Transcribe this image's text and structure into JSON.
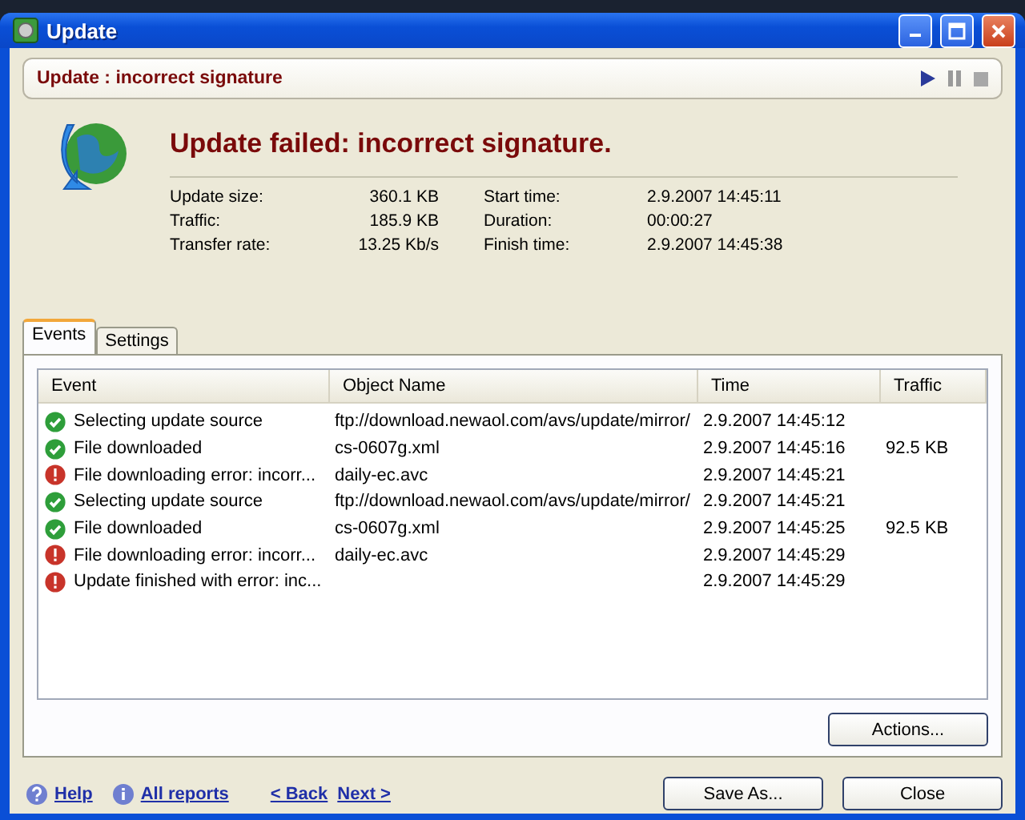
{
  "window": {
    "title": "Update"
  },
  "header": {
    "title": "Update : incorrect signature"
  },
  "status": {
    "heading": "Update failed: incorrect signature."
  },
  "info": [
    {
      "label": "Update size:",
      "value": "360.1 KB"
    },
    {
      "label": "Traffic:",
      "value": "185.9 KB"
    },
    {
      "label": "Transfer rate:",
      "value": "13.25 Kb/s"
    },
    {
      "label": "Start time:",
      "value": "2.9.2007 14:45:11"
    },
    {
      "label": "Duration:",
      "value": "00:00:27"
    },
    {
      "label": "Finish time:",
      "value": "2.9.2007 14:45:38"
    }
  ],
  "tabs": [
    {
      "label": "Events",
      "selected": true
    },
    {
      "label": "Settings",
      "selected": false
    }
  ],
  "table": {
    "columns": [
      "Event",
      "Object Name",
      "Time",
      "Traffic"
    ],
    "rows": [
      {
        "kind": "ok",
        "event": "Selecting update source",
        "object": "ftp://download.newaol.com/avs/update/mirror/",
        "time": "2.9.2007 14:45:12",
        "traffic": ""
      },
      {
        "kind": "ok",
        "event": "File downloaded",
        "object": "cs-0607g.xml",
        "time": "2.9.2007 14:45:16",
        "traffic": "92.5 KB"
      },
      {
        "kind": "error",
        "event": "File downloading error: incorr...",
        "object": "daily-ec.avc",
        "time": "2.9.2007 14:45:21",
        "traffic": ""
      },
      {
        "kind": "ok",
        "event": "Selecting update source",
        "object": "ftp://download.newaol.com/avs/update/mirror/",
        "time": "2.9.2007 14:45:21",
        "traffic": ""
      },
      {
        "kind": "ok",
        "event": "File downloaded",
        "object": "cs-0607g.xml",
        "time": "2.9.2007 14:45:25",
        "traffic": "92.5 KB"
      },
      {
        "kind": "error",
        "event": "File downloading error: incorr...",
        "object": "daily-ec.avc",
        "time": "2.9.2007 14:45:29",
        "traffic": ""
      },
      {
        "kind": "error",
        "event": "Update finished with error: inc...",
        "object": "",
        "time": "2.9.2007 14:45:29",
        "traffic": ""
      }
    ]
  },
  "actions_button": "Actions...",
  "footer": {
    "links": [
      {
        "kind": "help",
        "label": "Help"
      },
      {
        "kind": "info",
        "label": "All reports"
      },
      {
        "kind": "plain",
        "label": "< Back"
      },
      {
        "kind": "plain",
        "label": "Next >"
      }
    ],
    "buttons": [
      "Save As...",
      "Close"
    ]
  }
}
